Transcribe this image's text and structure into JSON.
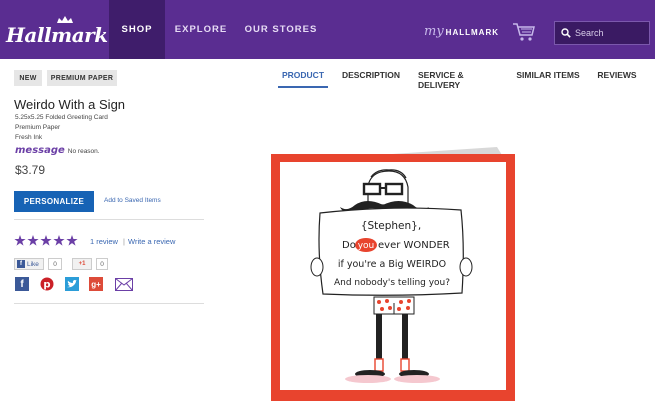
{
  "header": {
    "logo_text": "Hallmark",
    "nav": {
      "shop": "SHOP",
      "explore": "EXPLORE",
      "stores": "OUR STORES"
    },
    "my_hallmark": {
      "my": "my",
      "label": "HALLMARK"
    },
    "search_placeholder": "Search"
  },
  "badges": {
    "new": "NEW",
    "paper": "PREMIUM PAPER"
  },
  "tabs": {
    "product": "PRODUCT",
    "description": "DESCRIPTION",
    "delivery": "SERVICE & DELIVERY",
    "similar": "SIMILAR ITEMS",
    "reviews": "REVIEWS"
  },
  "product": {
    "title": "Weirdo With a Sign",
    "specs": [
      "5.25x5.25 Folded Greeting Card",
      "Premium Paper",
      "Fresh Ink"
    ],
    "message_logo": "message",
    "message_text": "No reason.",
    "price": "$3.79",
    "personalize_label": "PERSONALIZE",
    "saved_label": "Add to Saved Items",
    "rating": 5,
    "review_count_label": "1 review",
    "write_review_label": "Write a review",
    "separator": "|"
  },
  "social": {
    "like_label": "Like",
    "like_count": "0",
    "gplus_label": "+1",
    "gplus_count": "0"
  },
  "card_text": {
    "line1": "{Stephen},",
    "line2a": "Do",
    "line2b": "you",
    "line2c": "ever WONDER",
    "line3": "if you're a Big WEIRDO",
    "line4": "And nobody's telling you?"
  },
  "colors": {
    "header": "#5a2d91",
    "accent_blue": "#1763b5",
    "card_border": "#e8442e",
    "star": "#6b3fa6"
  }
}
